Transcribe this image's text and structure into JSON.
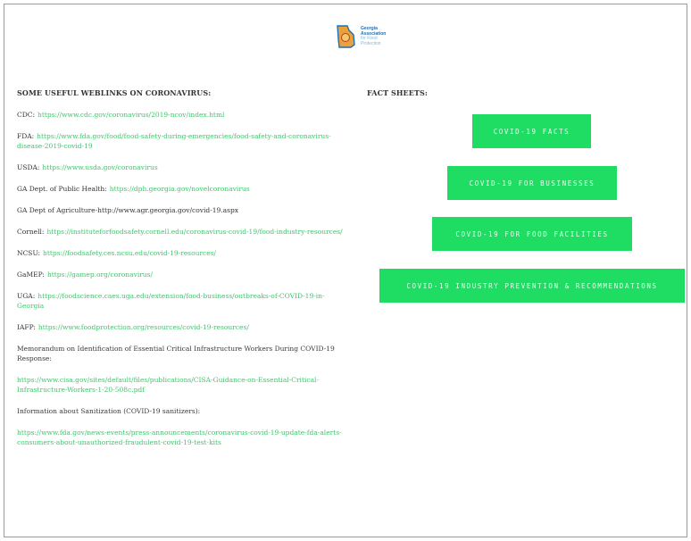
{
  "logo": {
    "line1": "Georgia",
    "line2": "Association",
    "line3": "for Food",
    "line4": "Protection"
  },
  "left": {
    "heading": "SOME USEFUL WEBLINKS ON CORONAVIRUS:",
    "links": [
      {
        "label": "CDC:",
        "url": "https://www.cdc.gov/coronavirus/2019-ncov/index.html"
      },
      {
        "label": "FDA:",
        "url": "https://www.fda.gov/food/food-safety-during-emergencies/food-safety-and-coronavirus-disease-2019-covid-19"
      },
      {
        "label": "USDA:",
        "url": "https://www.usda.gov/coronavirus"
      },
      {
        "label": "GA Dept. of Public Health:",
        "url": "https://dph.georgia.gov/novelcoronavirus"
      },
      {
        "label": "GA Dept of Agriculture-http://www.agr.georgia.gov/covid-19.aspx",
        "url": ""
      },
      {
        "label": "Cornell:",
        "url": "https://instituteforfoodsafety.cornell.edu/coronavirus-covid-19/food-industry-resources/"
      },
      {
        "label": "NCSU:",
        "url": "https://foodsafety.ces.ncsu.edu/covid-19-resources/"
      },
      {
        "label": "GaMEP:",
        "url": "https://gamep.org/coronavirus/"
      },
      {
        "label": "UGA:",
        "url": "https://foodscience.caes.uga.edu/extension/food-business/outbreaks-of-COVID-19-in-Georgia"
      },
      {
        "label": "IAFP:",
        "url": "https://www.foodprotection.org/resources/covid-19-resources/"
      }
    ],
    "memo_text": "Memorandum on Identification of Essential Critical Infrastructure Workers During COVID-19 Response:",
    "memo_url": "https://www.cisa.gov/sites/default/files/publications/CISA-Guidance-on-Essential-Critical-Infrastructure-Workers-1-20-508c.pdf",
    "sanitizer_text": "Information about Sanitization (COVID-19 sanitizers):",
    "sanitizer_url": "https://www.fda.gov/news-events/press-announcements/coronavirus-covid-19-update-fda-alerts-consumers-about-unauthorized-fraudulent-covid-19-test-kits"
  },
  "right": {
    "heading": "FACT SHEETS:",
    "buttons": [
      "COVID-19 FACTS",
      "COVID-19 FOR BUSINESSES",
      "COVID-19 FOR FOOD FACILITIES",
      "COVID-19 INDUSTRY PREVENTION & RECOMMENDATIONS"
    ]
  },
  "colors": {
    "button_green": "#1fdc62",
    "link_green": "#3fc66b"
  }
}
